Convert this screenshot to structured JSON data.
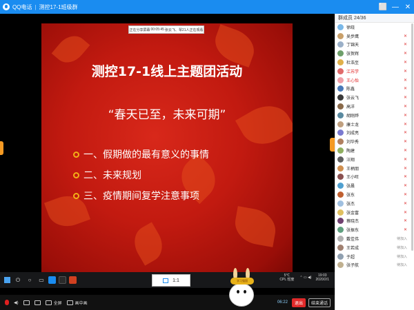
{
  "window": {
    "app_name": "QQ电话",
    "group_name": "测控17-1班级群",
    "separator": "|",
    "buttons": [
      "⬜",
      "—",
      "✕"
    ]
  },
  "share_bar": {
    "status": "正在分享屏幕",
    "timer": "00:05:45",
    "viewers": "张云飞、琴21人正在观看"
  },
  "slide": {
    "title": "测控17-1线上主题团活动",
    "subtitle": "“春天已至，未来可期”",
    "items": [
      "一、假期做的最有意义的事情",
      "二、未来规划",
      "三、疫情期间复学注意事项"
    ]
  },
  "taskbar": {
    "ratio": "1:1",
    "weather_temp": "5℃",
    "weather_aqi": "CPL 轻度",
    "clock_time": "19:03",
    "clock_date": "2020/2/1"
  },
  "mascot": {
    "label": "学习强国"
  },
  "controls": {
    "fullscreen": "全屏",
    "pip": "画中画",
    "time": "06:22",
    "exit": "退出",
    "end_call": "结束通话"
  },
  "panel": {
    "header": "群成员 24/36",
    "members": [
      {
        "name": "徐晓",
        "status": "",
        "avatar": "#7ab8e8",
        "red": false
      },
      {
        "name": "吴步鹰",
        "status": "✕",
        "avatar": "#c9a06a",
        "red": false
      },
      {
        "name": "丁锦天",
        "status": "✕",
        "avatar": "#9bb0c8",
        "red": false
      },
      {
        "name": "张贺辉",
        "status": "✕",
        "avatar": "#6e9f6a",
        "red": false
      },
      {
        "name": "杜浩至",
        "status": "✕",
        "avatar": "#e0b04a",
        "red": false
      },
      {
        "name": "江苏学",
        "status": "✕",
        "avatar": "#e06a6a",
        "red": true
      },
      {
        "name": "王心怡",
        "status": "✕",
        "avatar": "#f0a0a8",
        "red": true
      },
      {
        "name": "陈鑫",
        "status": "✕",
        "avatar": "#4a7ab8",
        "red": false
      },
      {
        "name": "张云飞",
        "status": "✕",
        "avatar": "#3a3a3a",
        "red": false
      },
      {
        "name": "高洋",
        "status": "✕",
        "avatar": "#8a6a4a",
        "red": false
      },
      {
        "name": "胡刚烨",
        "status": "✕",
        "avatar": "#5a8aa0",
        "red": false
      },
      {
        "name": "康士龙",
        "status": "✕",
        "avatar": "#c0a080",
        "red": false
      },
      {
        "name": "刘成亮",
        "status": "✕",
        "avatar": "#7a7ad0",
        "red": false
      },
      {
        "name": "刘华秀",
        "status": "✕",
        "avatar": "#b08060",
        "red": false
      },
      {
        "name": "陶建",
        "status": "✕",
        "avatar": "#90b060",
        "red": false
      },
      {
        "name": "汪翔",
        "status": "✕",
        "avatar": "#606060",
        "red": false
      },
      {
        "name": "王柄朋",
        "status": "✕",
        "avatar": "#d09050",
        "red": false
      },
      {
        "name": "王小旺",
        "status": "✕",
        "avatar": "#8a5050",
        "red": false
      },
      {
        "name": "张晨",
        "status": "✕",
        "avatar": "#50a0d0",
        "red": false
      },
      {
        "name": "张东",
        "status": "✕",
        "avatar": "#c06030",
        "red": false
      },
      {
        "name": "张杰",
        "status": "✕",
        "avatar": "#a0c0e0",
        "red": false
      },
      {
        "name": "张金富",
        "status": "✕",
        "avatar": "#e0c060",
        "red": false
      },
      {
        "name": "蔡晓杰",
        "status": "✕",
        "avatar": "#704070",
        "red": false
      },
      {
        "name": "张振东",
        "status": "✕",
        "avatar": "#60a080",
        "red": false
      },
      {
        "name": "戴佳伟",
        "status": "待加入",
        "avatar": "#b0b0b0",
        "red": false
      },
      {
        "name": "王若成",
        "status": "待加入",
        "avatar": "#a08070",
        "red": false
      },
      {
        "name": "于超",
        "status": "待加入",
        "avatar": "#90a0b0",
        "red": false
      },
      {
        "name": "张子航",
        "status": "待加入",
        "avatar": "#c0b090",
        "red": false
      }
    ]
  }
}
